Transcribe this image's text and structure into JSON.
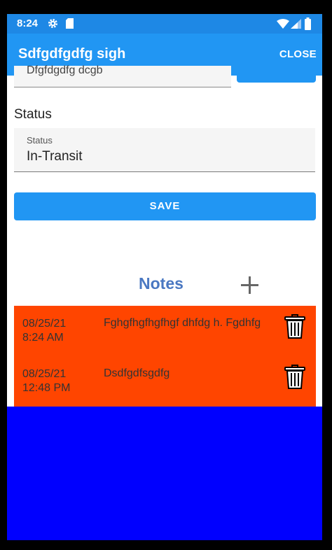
{
  "status_bar": {
    "time": "8:24",
    "icons": [
      "gear-icon",
      "sd-card-icon",
      "wifi-icon",
      "signal-icon",
      "battery-icon"
    ]
  },
  "app_bar": {
    "title": "Sdfgdfgdfg sigh",
    "close_label": "CLOSE"
  },
  "form": {
    "previous_field_value": "Dfgfdgdfg dcgb",
    "status_section_label": "Status",
    "status_field": {
      "label": "Status",
      "value": "In-Transit"
    },
    "save_label": "SAVE"
  },
  "notes": {
    "title": "Notes",
    "add_icon": "plus-icon",
    "items": [
      {
        "date": "08/25/21",
        "time": "8:24 AM",
        "text": "Fghgfhgfhgfhgf dhfdg h. Fgdhfg"
      },
      {
        "date": "08/25/21",
        "time": "12:48 PM",
        "text": "Dsdfgdfsgdfg"
      }
    ]
  },
  "colors": {
    "status_bar": "#1e88e5",
    "app_bar": "#2196f3",
    "notes_title": "#4a78c2",
    "notes_background": "#ff4500",
    "bottom_block": "#0000ff"
  }
}
